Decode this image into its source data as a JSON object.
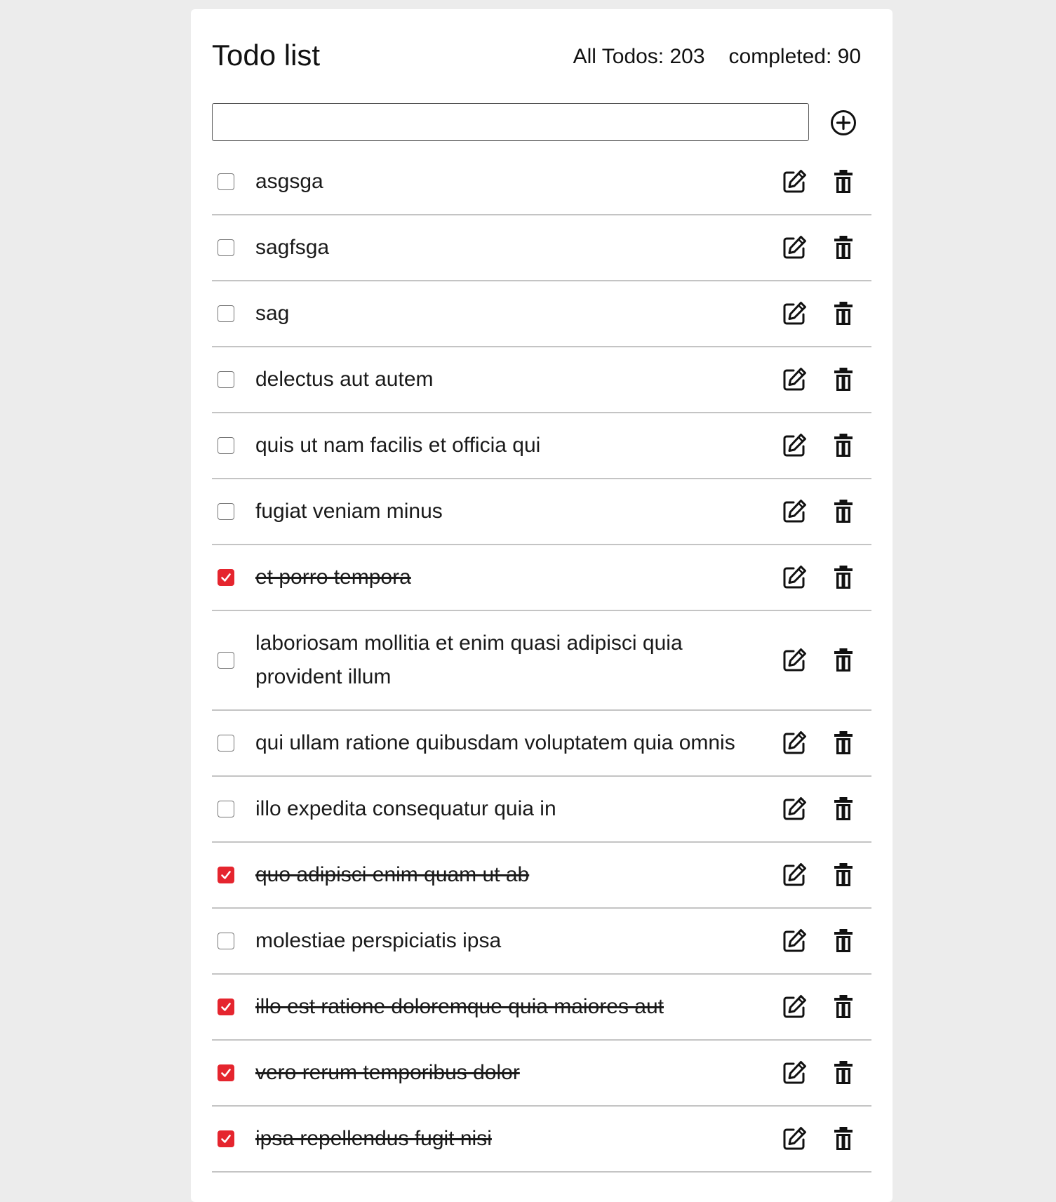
{
  "header": {
    "title": "Todo list",
    "all_todos": "All Todos: 203",
    "completed": "completed: 90"
  },
  "add_form": {
    "input_value": "",
    "placeholder": "",
    "add_icon": "plus-circle-icon"
  },
  "icons": {
    "edit": "edit-icon",
    "delete": "trash-icon",
    "check": "checkmark-icon"
  },
  "colors": {
    "accent": "#e5252e",
    "page_background": "#ececec",
    "card_background": "#ffffff",
    "divider": "#c4c4c4"
  },
  "todos": [
    {
      "text": "asgsga",
      "completed": false
    },
    {
      "text": "sagfsga",
      "completed": false
    },
    {
      "text": "sag",
      "completed": false
    },
    {
      "text": "delectus aut autem",
      "completed": false
    },
    {
      "text": "quis ut nam facilis et officia qui",
      "completed": false
    },
    {
      "text": "fugiat veniam minus",
      "completed": false
    },
    {
      "text": "et porro tempora",
      "completed": true
    },
    {
      "text": "laboriosam mollitia et enim quasi adipisci quia provident illum",
      "completed": false
    },
    {
      "text": "qui ullam ratione quibusdam voluptatem quia omnis",
      "completed": false
    },
    {
      "text": "illo expedita consequatur quia in",
      "completed": false
    },
    {
      "text": "quo adipisci enim quam ut ab",
      "completed": true
    },
    {
      "text": "molestiae perspiciatis ipsa",
      "completed": false
    },
    {
      "text": "illo est ratione doloremque quia maiores aut",
      "completed": true
    },
    {
      "text": "vero rerum temporibus dolor",
      "completed": true
    },
    {
      "text": "ipsa repellendus fugit nisi",
      "completed": true
    }
  ]
}
